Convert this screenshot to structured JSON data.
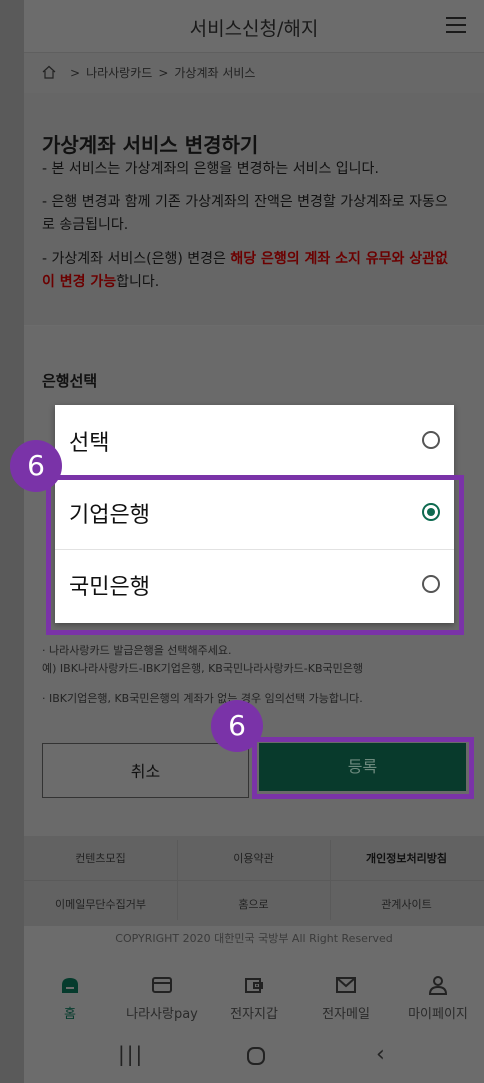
{
  "header": {
    "title": "서비스신청/해지"
  },
  "breadcrumb": {
    "items": [
      "나라사랑카드",
      "가상계좌 서비스"
    ]
  },
  "content": {
    "heading": "가상계좌 서비스 변경하기",
    "bullet1": "- 본 서비스는 가상계좌의 은행을 변경하는 서비스 입니다.",
    "bullet2_line1": "- 은행 변경과 함께 기존 가상계좌의 잔액은 변경할 가상계좌로 자동으",
    "bullet2_line2": "로 송금됩니다.",
    "bullet3_prefix": "- 가상계좌 서비스(은행) 변경은 ",
    "bullet3_red_line1": "해당 은행의 계좌 소지 유무와 상관없",
    "bullet3_red_line2": "이 변경 가능",
    "bullet3_suffix": "합니다."
  },
  "bank_select": {
    "label": "은행선택",
    "options": [
      {
        "label": "선택",
        "selected": false
      },
      {
        "label": "기업은행",
        "selected": true
      },
      {
        "label": "국민은행",
        "selected": false
      }
    ]
  },
  "notes": {
    "note1_line1": "· 나라사랑카드 발급은행을 선택해주세요.",
    "note1_line2": "예) IBK나라사랑카드-IBK기업은행, KB국민나라사랑카드-KB국민은행",
    "note2": "· IBK기업은행, KB국민은행의 계좌가 없는 경우 임의선택 가능합니다."
  },
  "buttons": {
    "cancel": "취소",
    "submit": "등록"
  },
  "footer": {
    "links_row1": [
      "컨텐츠모집",
      "이용약관",
      "개인정보처리방침"
    ],
    "links_row2": [
      "이메일무단수집거부",
      "홈으로",
      "관계사이트"
    ],
    "copyright": "COPYRIGHT 2020 대한민국 국방부 All Right Reserved"
  },
  "bottom_nav": {
    "items": [
      {
        "label": "홈",
        "icon": "home-icon"
      },
      {
        "label": "나라사랑pay",
        "icon": "card-icon"
      },
      {
        "label": "전자지갑",
        "icon": "wallet-icon"
      },
      {
        "label": "전자메일",
        "icon": "mail-icon"
      },
      {
        "label": "마이페이지",
        "icon": "person-icon"
      }
    ]
  },
  "annotations": {
    "badge_options": "6",
    "badge_submit": "6"
  },
  "colors": {
    "highlight": "#7a33a8",
    "accent": "#0e6a50",
    "submit_bg": "#083a2c"
  }
}
